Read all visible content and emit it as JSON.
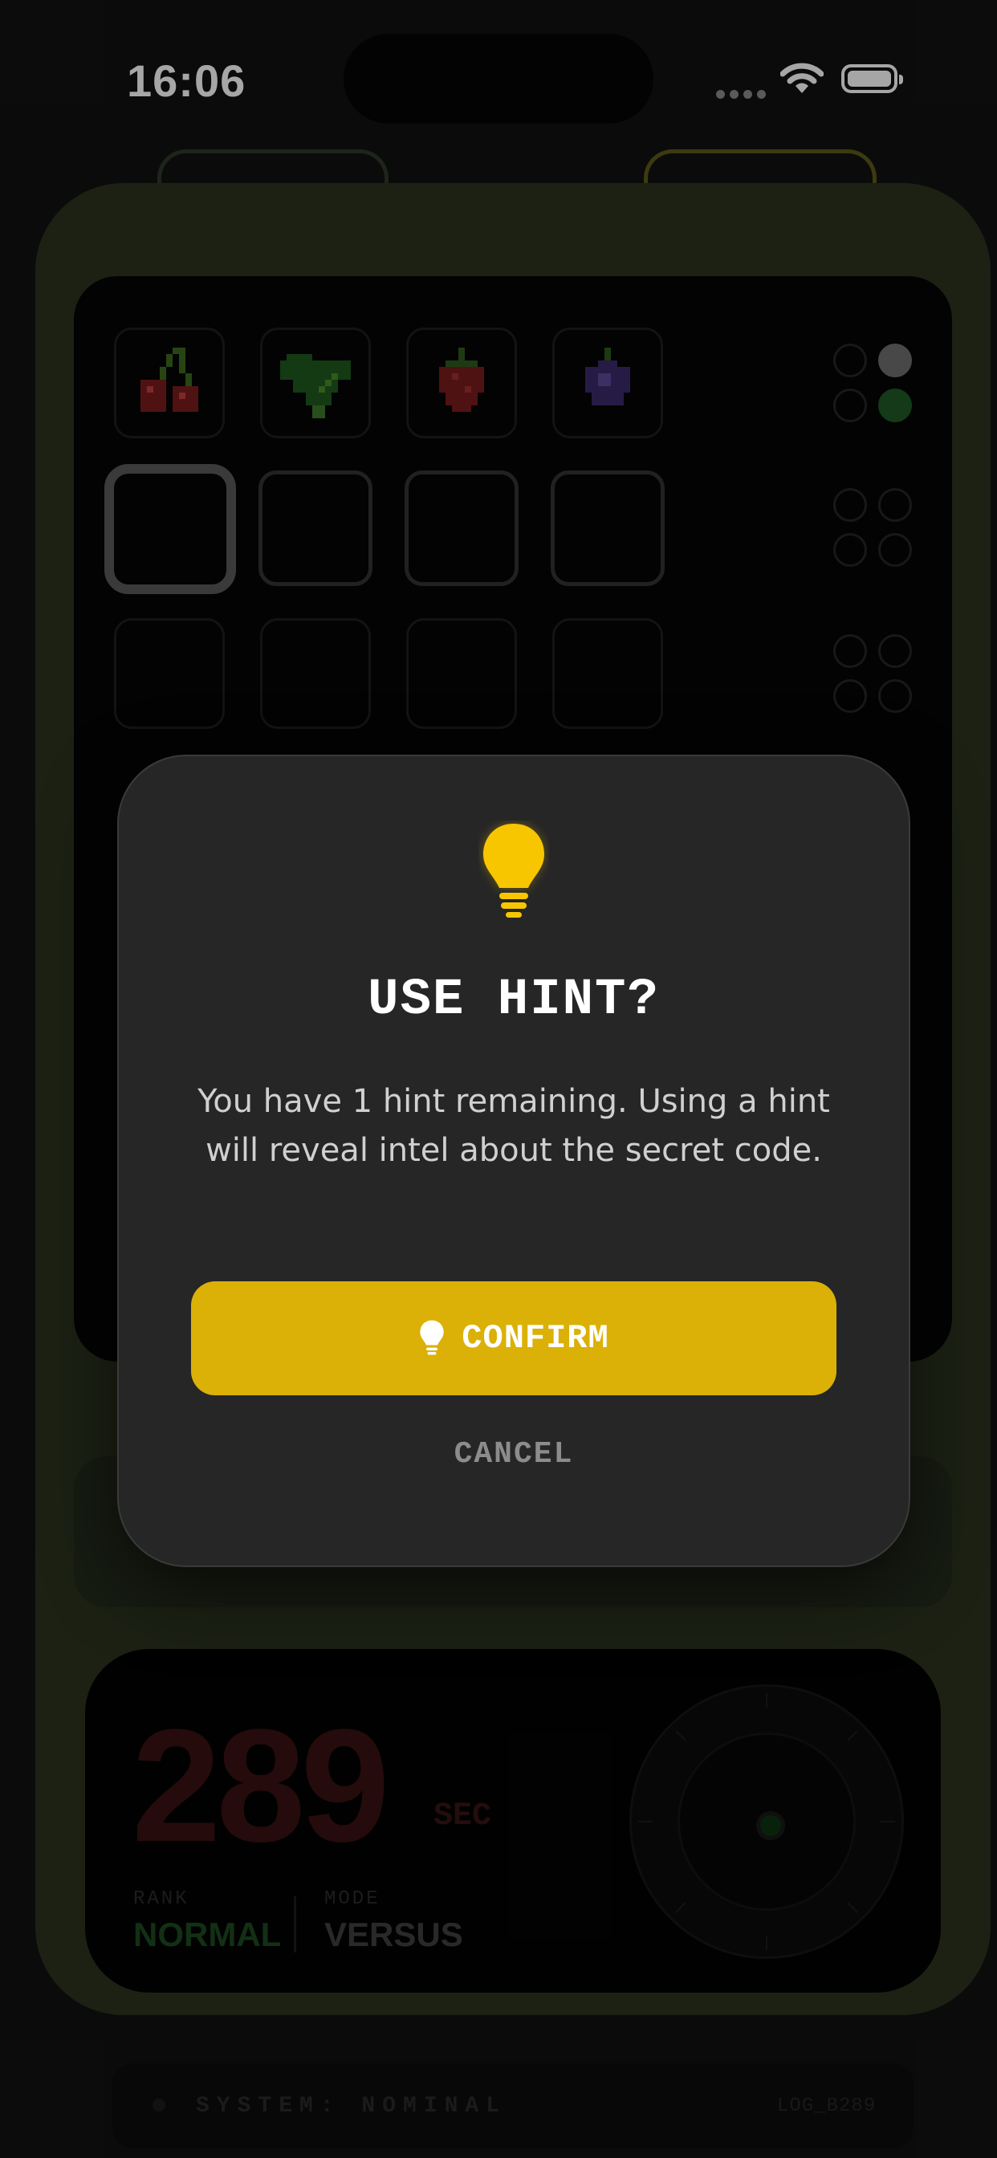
{
  "status_bar": {
    "time": "16:06"
  },
  "board": {
    "guess_row": [
      {
        "icon": "cherry-icon"
      },
      {
        "icon": "leaf-icon"
      },
      {
        "icon": "strawberry-icon"
      },
      {
        "icon": "plum-icon"
      }
    ],
    "feedback_pegs_row1": [
      "empty",
      "white",
      "empty",
      "green"
    ]
  },
  "timer": {
    "value": "289",
    "unit": "SEC"
  },
  "rank": {
    "label": "RANK",
    "value": "NORMAL"
  },
  "mode": {
    "label": "MODE",
    "value": "VERSUS"
  },
  "system": {
    "status": "SYSTEM: NOMINAL",
    "log_id": "LOG_B289"
  },
  "dialog": {
    "icon": "lightbulb-icon",
    "title": "USE HINT?",
    "message": "You have 1 hint remaining. Using a hint will reveal intel about the secret code.",
    "confirm_label": "CONFIRM",
    "cancel_label": "CANCEL"
  },
  "colors": {
    "accent": "#dbb108",
    "bulb": "#f7c600",
    "device": "#2b3420",
    "dialog_bg": "#262626"
  }
}
